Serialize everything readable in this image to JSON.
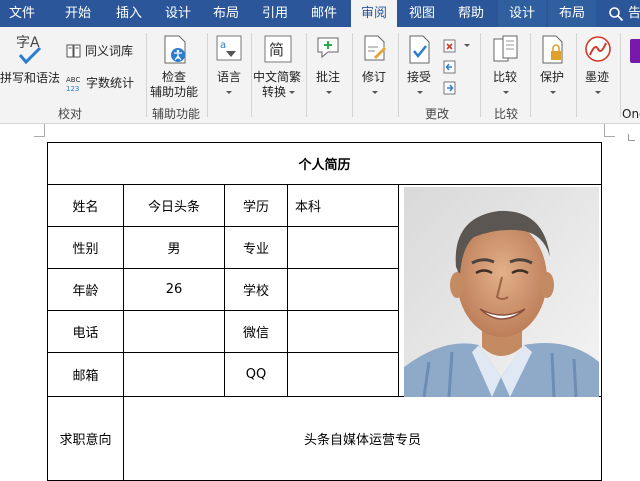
{
  "tabs": [
    {
      "label": "文件",
      "active": false
    },
    {
      "label": "开始",
      "active": false
    },
    {
      "label": "插入",
      "active": false
    },
    {
      "label": "设计",
      "active": false
    },
    {
      "label": "布局",
      "active": false
    },
    {
      "label": "引用",
      "active": false
    },
    {
      "label": "邮件",
      "active": false
    },
    {
      "label": "审阅",
      "active": true
    },
    {
      "label": "视图",
      "active": false
    },
    {
      "label": "帮助",
      "active": false
    },
    {
      "label": "设计",
      "active": false
    },
    {
      "label": "布局",
      "active": false
    }
  ],
  "tell_me": "告",
  "ribbon": {
    "proofing": {
      "spelling_label": "拼写和语法",
      "thesaurus_label": "同义词库",
      "wordcount_label": "字数统计",
      "group_label": "校对"
    },
    "accessibility": {
      "check_label_1": "检查",
      "check_label_2": "辅助功能",
      "group_label": "辅助功能"
    },
    "language_label": "语言",
    "chinese_convert_1": "中文简繁",
    "chinese_convert_2": "转换",
    "comments_label": "批注",
    "tracking_label": "修订",
    "changes": {
      "accept_label": "接受",
      "group_label": "更改"
    },
    "compare": {
      "compare_label": "比较",
      "group_label": "比较"
    },
    "protect_label": "保护",
    "ink_label": "墨迹",
    "onenote_label": "One"
  },
  "document": {
    "title": "个人简历",
    "rows": [
      {
        "label1": "姓名",
        "value1": "今日头条",
        "label2": "学历",
        "value2": "本科"
      },
      {
        "label1": "性别",
        "value1": "男",
        "label2": "专业",
        "value2": ""
      },
      {
        "label1": "年龄",
        "value1": "26",
        "label2": "学校",
        "value2": ""
      },
      {
        "label1": "电话",
        "value1": "",
        "label2": "微信",
        "value2": ""
      },
      {
        "label1": "邮箱",
        "value1": "",
        "label2": "QQ",
        "value2": ""
      }
    ],
    "objective_label": "求职意向",
    "objective_value": "头条自媒体运营专员"
  }
}
